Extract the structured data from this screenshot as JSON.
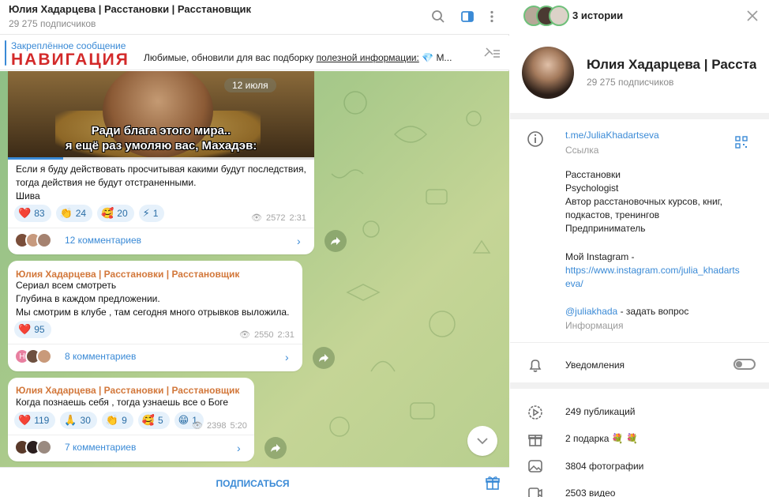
{
  "chat": {
    "title": "Юлия Хадарцева | Расстановки | Расстановщик",
    "subscribers": "29 275 подписчиков",
    "pinned": {
      "label": "Закреплённое сообщение",
      "nav_word": "НАВИГАЦИЯ",
      "text_before": "Любимые, обновили для вас подборку ",
      "text_link": "полезной информации:",
      "text_after": " 💎 М..."
    },
    "messages": [
      {
        "video": {
          "subtitle1": "Ради блага этого мира..",
          "subtitle2": "я ещё раз умоляю вас, Махадэв:",
          "date": "12 июля"
        },
        "lines": [
          "Если я буду действовать просчитывая какими будут последствия,",
          "тогда действия не будут отстраненными.",
          "Шива"
        ],
        "reactions": [
          {
            "emoji": "❤️",
            "count": "83"
          },
          {
            "emoji": "👏",
            "count": "24"
          },
          {
            "emoji": "🥰",
            "count": "20"
          },
          {
            "emoji": "⚡",
            "count": "1"
          }
        ],
        "views": "2572",
        "time": "2:31",
        "comments": "12 комментариев"
      },
      {
        "author": "Юлия Хадарцева | Расстановки | Расстановщик",
        "lines": [
          "Сериал всем смотреть",
          "Глубина в каждом предложении.",
          "Мы смотрим в клубе , там сегодня много отрывков выложила."
        ],
        "reactions": [
          {
            "emoji": "❤️",
            "count": "95"
          }
        ],
        "views": "2550",
        "time": "2:31",
        "comments": "8 комментариев",
        "first_avatar_letter": "Н"
      },
      {
        "author": "Юлия Хадарцева | Расстановки | Расстановщик",
        "lines": [
          "Когда познаешь себя , тогда узнаешь все о Боге"
        ],
        "reactions": [
          {
            "emoji": "❤️",
            "count": "119"
          },
          {
            "emoji": "🙏",
            "count": "30"
          },
          {
            "emoji": "👏",
            "count": "9"
          },
          {
            "emoji": "🥰",
            "count": "5"
          },
          {
            "emoji": "😁",
            "count": "1"
          }
        ],
        "views": "2398",
        "time": "5:20",
        "comments": "7 комментариев"
      }
    ],
    "subscribe": "ПОДПИСАТЬСЯ"
  },
  "panel": {
    "stories": "3 истории",
    "name": "Юлия Хадарцева | Расстан...",
    "subscribers": "29 275 подписчиков",
    "link": "t.me/JuliaKhadartseva",
    "link_label": "Ссылка",
    "bio": [
      "Расстановки",
      "Psychologist",
      "Автор расстановочных курсов, книг,",
      "подкастов, тренингов",
      "Предприниматель"
    ],
    "instagram_label": "Мой Instagram -",
    "instagram_url1": "https://www.instagram.com/julia_khadarts",
    "instagram_url2": "eva/",
    "handle": "@juliakhada",
    "handle_suffix": " - задать вопрос",
    "info_label": "Информация",
    "notifications": "Уведомления",
    "stats": {
      "posts": "249 публикаций",
      "gifts": "2 подарка",
      "gift_emojis": "💐 💐",
      "photos": "3804 фотографии",
      "videos": "2503 видео"
    }
  },
  "colors": {
    "accent": "#3a8ad6",
    "author": "#d2773a",
    "nav_red": "#d32a2a"
  }
}
